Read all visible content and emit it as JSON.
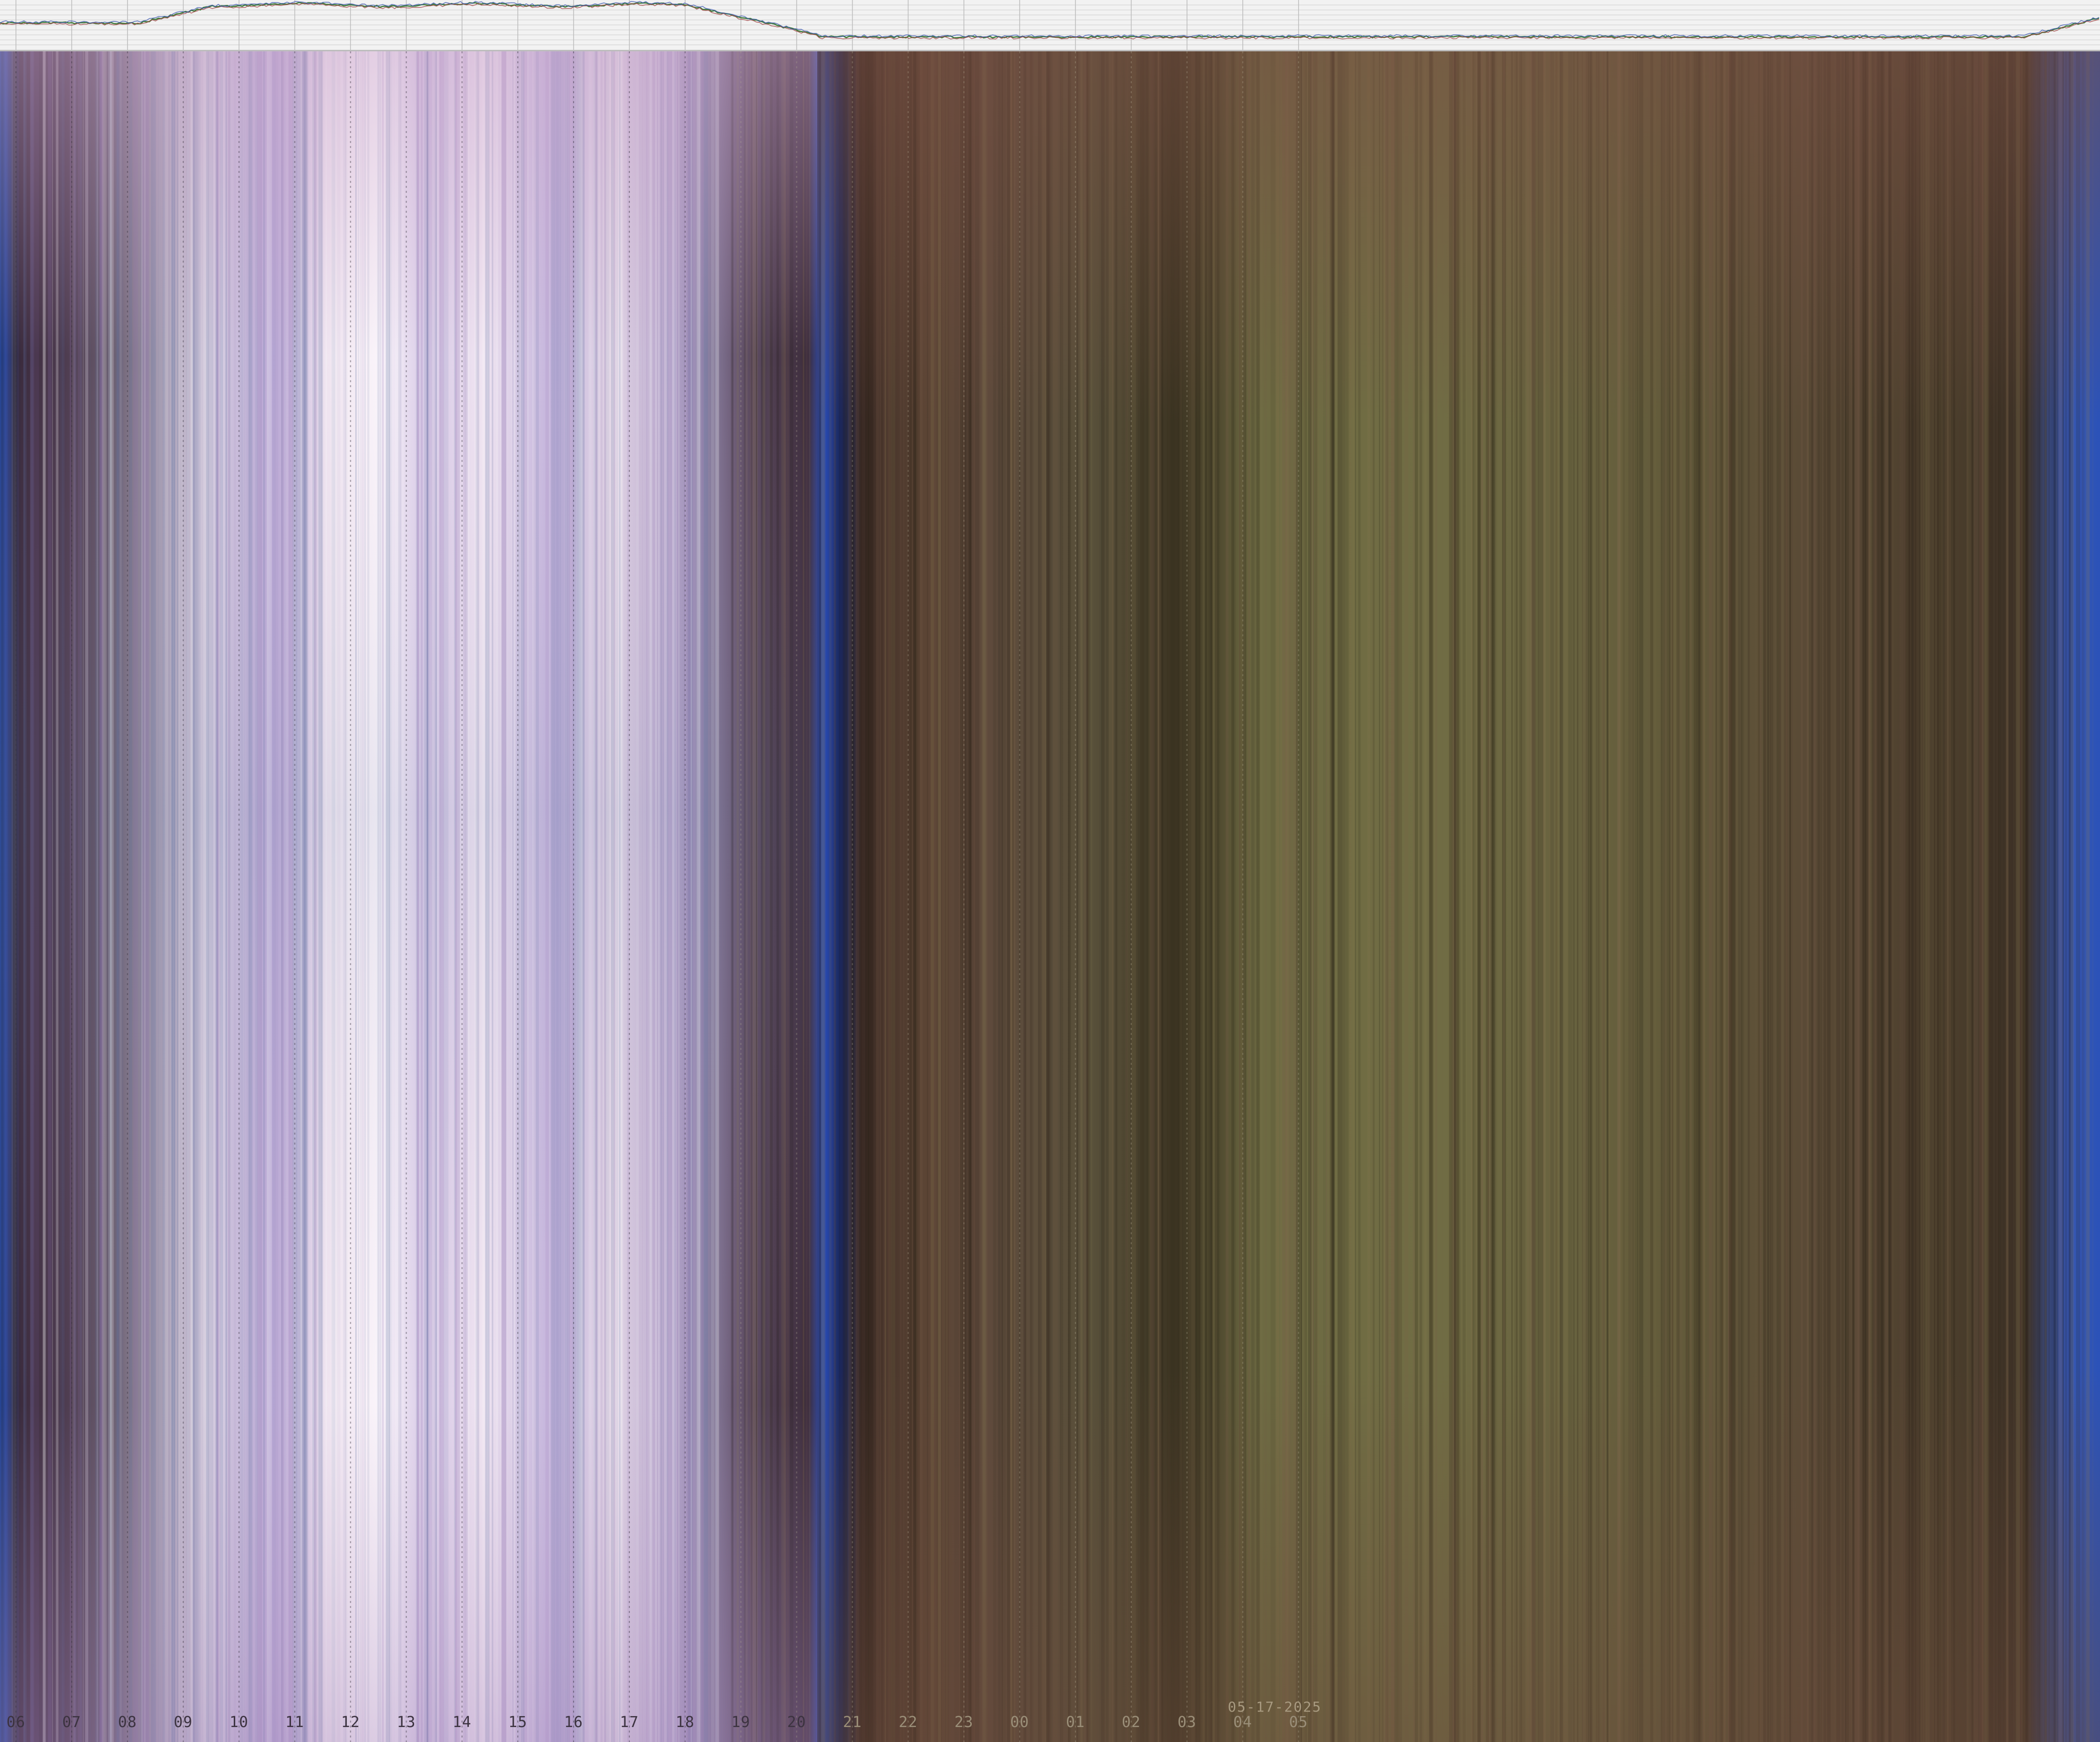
{
  "keogram": {
    "date_label": "05-17-2025",
    "hour_labels": [
      "06",
      "07",
      "08",
      "09",
      "10",
      "11",
      "12",
      "13",
      "14",
      "15",
      "16",
      "17",
      "18",
      "19",
      "20",
      "21",
      "22",
      "23",
      "00",
      "01",
      "02",
      "03",
      "04",
      "05"
    ],
    "colors": {
      "twilight_blue": "#2b52b8",
      "day_white": "#f4eef6",
      "day_lavender": "#b7a3d6",
      "day_slate": "#7f8aa6",
      "dusk_mauve": "#5a4658",
      "night_brown": "#6b4e40",
      "night_olive": "#6e6a3c",
      "night_dark": "#332c1f"
    }
  }
}
